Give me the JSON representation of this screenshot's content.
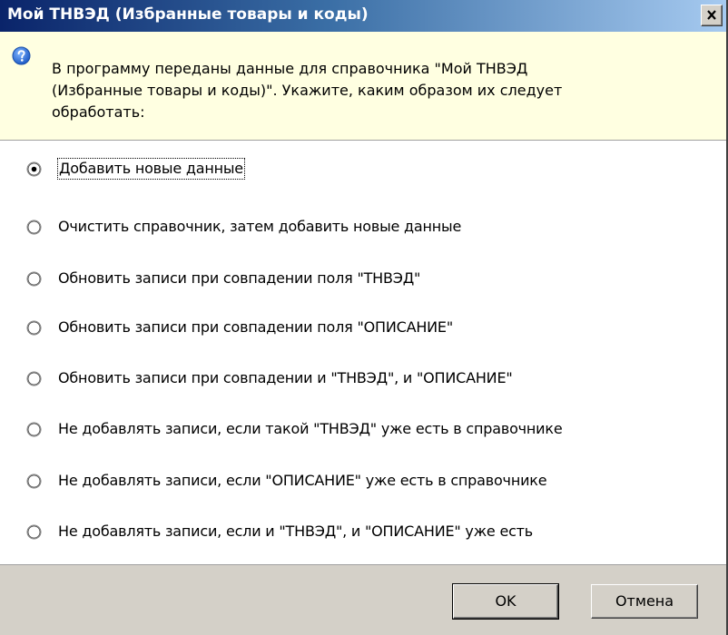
{
  "window": {
    "title": "Мой ТНВЭД (Избранные товары и коды)",
    "close_glyph": "✕"
  },
  "info": {
    "icon": "question-icon",
    "lines": [
      "В программу переданы данные для справочника \"Мой ТНВЭД",
      "(Избранные товары и коды)\". Укажите, каким образом их следует",
      "обработать:"
    ]
  },
  "options": [
    {
      "label": "Добавить новые данные",
      "selected": true
    },
    {
      "label": "Очистить справочник, затем добавить новые данные",
      "selected": false
    },
    {
      "label": "Обновить записи при совпадении поля \"ТНВЭД\"",
      "selected": false
    },
    {
      "label": "Обновить записи при совпадении поля \"ОПИСАНИЕ\"",
      "selected": false
    },
    {
      "label": "Обновить записи при совпадении и \"ТНВЭД\", и \"ОПИСАНИЕ\"",
      "selected": false
    },
    {
      "label": "Не добавлять записи, если такой \"ТНВЭД\" уже есть в справочнике",
      "selected": false
    },
    {
      "label": "Не добавлять записи, если \"ОПИСАНИЕ\" уже есть в справочнике",
      "selected": false
    },
    {
      "label": "Не добавлять записи, если и \"ТНВЭД\", и \"ОПИСАНИЕ\" уже есть",
      "selected": false
    }
  ],
  "buttons": {
    "ok_label": "OK",
    "cancel_label": "Отмена"
  },
  "colors": {
    "title_gradient_start": "#0a246a",
    "title_gradient_end": "#a6caf0",
    "info_background": "#ffffe1",
    "dialog_face": "#d4d0c8",
    "question_icon": "#2d72d9"
  }
}
